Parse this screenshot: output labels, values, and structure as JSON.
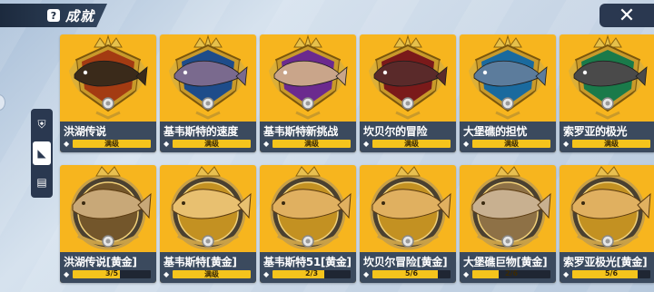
{
  "header": {
    "title": "成就",
    "title_icon": "?",
    "close_glyph": "✕"
  },
  "side_tabs": [
    {
      "icon": "shield-icon",
      "glyph": "⛨",
      "active": false
    },
    {
      "icon": "fin-icon",
      "glyph": "◣",
      "active": true
    },
    {
      "icon": "book-icon",
      "glyph": "▤",
      "active": false
    }
  ],
  "colors": {
    "card_bg": "#f7b51e",
    "label_bg": "#3b4a5e",
    "bar_fill": "#f5c41c"
  },
  "achievements": [
    {
      "name": "洪湖传说",
      "progress_text": "满级",
      "progress": 1.0,
      "tier": "classic",
      "gem": "#a33b12",
      "fish": "#3a2a1a"
    },
    {
      "name": "基韦斯特的速度",
      "progress_text": "满级",
      "progress": 1.0,
      "tier": "classic",
      "gem": "#1e4c8a",
      "fish": "#7a6a8e"
    },
    {
      "name": "基韦斯特新挑战",
      "progress_text": "满级",
      "progress": 1.0,
      "tier": "classic",
      "gem": "#6b2a8e",
      "fish": "#c9a58a"
    },
    {
      "name": "坎贝尔的冒险",
      "progress_text": "满级",
      "progress": 1.0,
      "tier": "classic",
      "gem": "#7a1a1a",
      "fish": "#5a2a2a"
    },
    {
      "name": "大堡礁的担忧",
      "progress_text": "满级",
      "progress": 1.0,
      "tier": "classic",
      "gem": "#1a6a9e",
      "fish": "#5c7c9c"
    },
    {
      "name": "索罗亚的极光",
      "progress_text": "满级",
      "progress": 1.0,
      "tier": "classic",
      "gem": "#1a7a4a",
      "fish": "#4a4a4a"
    },
    {
      "name": "洪湖传说[黄金]",
      "progress_text": "3/5",
      "progress": 0.6,
      "tier": "gold",
      "gem": "#7a5a2a",
      "fish": "#c8a878"
    },
    {
      "name": "基韦斯特[黄金]",
      "progress_text": "满级",
      "progress": 1.0,
      "tier": "gold",
      "gem": "#d8a020",
      "fish": "#e8c070"
    },
    {
      "name": "基韦斯特51[黄金]",
      "progress_text": "2/3",
      "progress": 0.667,
      "tier": "gold",
      "gem": "#d8a020",
      "fish": "#e0b060"
    },
    {
      "name": "坎贝尔冒险[黄金]",
      "progress_text": "5/6",
      "progress": 0.833,
      "tier": "gold",
      "gem": "#d8a020",
      "fish": "#e0b060"
    },
    {
      "name": "大堡礁巨物[黄金]",
      "progress_text": "2/6",
      "progress": 0.333,
      "tier": "gold",
      "gem": "#9a7a4a",
      "fish": "#c8b090"
    },
    {
      "name": "索罗亚极光[黄金]",
      "progress_text": "5/6",
      "progress": 0.833,
      "tier": "gold",
      "gem": "#d8a020",
      "fish": "#e0b060"
    }
  ]
}
